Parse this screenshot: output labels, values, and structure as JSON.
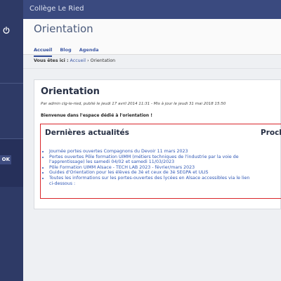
{
  "app": {
    "site_name": "Collège Le Ried",
    "ok_label": "OK"
  },
  "page": {
    "title": "Orientation",
    "tabs": [
      {
        "label": "Accueil",
        "active": true
      },
      {
        "label": "Blog",
        "active": false
      },
      {
        "label": "Agenda",
        "active": false
      }
    ],
    "breadcrumb": {
      "lead": "Vous êtes ici :",
      "home": "Accueil",
      "separator": "›",
      "current": "Orientation"
    }
  },
  "article": {
    "title": "Orientation",
    "meta": "Par admin clg-le-ried, publié le jeudi 17 avril 2014 11:31 - Mis à jour le jeudi 31 mai 2018 15:50",
    "welcome": "Bienvenue dans l'espace dédié à l'orientation !",
    "latest_heading": "Dernières actualités",
    "right_heading": "Proch",
    "news": [
      "Journée portes ouvertes Compagnons du Devoir 11 mars 2023",
      "Portes ouvertes Pôle formation UIMM (métiers techniques de l'industrie par la voie de l'apprentissage) les samedi 04/02 et samedi 11/03/2023",
      "Pôle Formation UIMM Alsace - TECH LAB 2023 - février/mars 2023",
      "Guides d'Orientation pour les élèves de 3è et ceux de 3è SEGPA et ULIS",
      "Toutes les informations sur les portes-ouvertes des lycées en Alsace accessibles via le lien ci-dessous :"
    ]
  },
  "colors": {
    "sidebar": "#2e3a66",
    "topbar": "#3a4a7f",
    "link": "#2f57b5",
    "highlight_box": "#d9262b"
  },
  "icons": {
    "power": "power-icon"
  }
}
